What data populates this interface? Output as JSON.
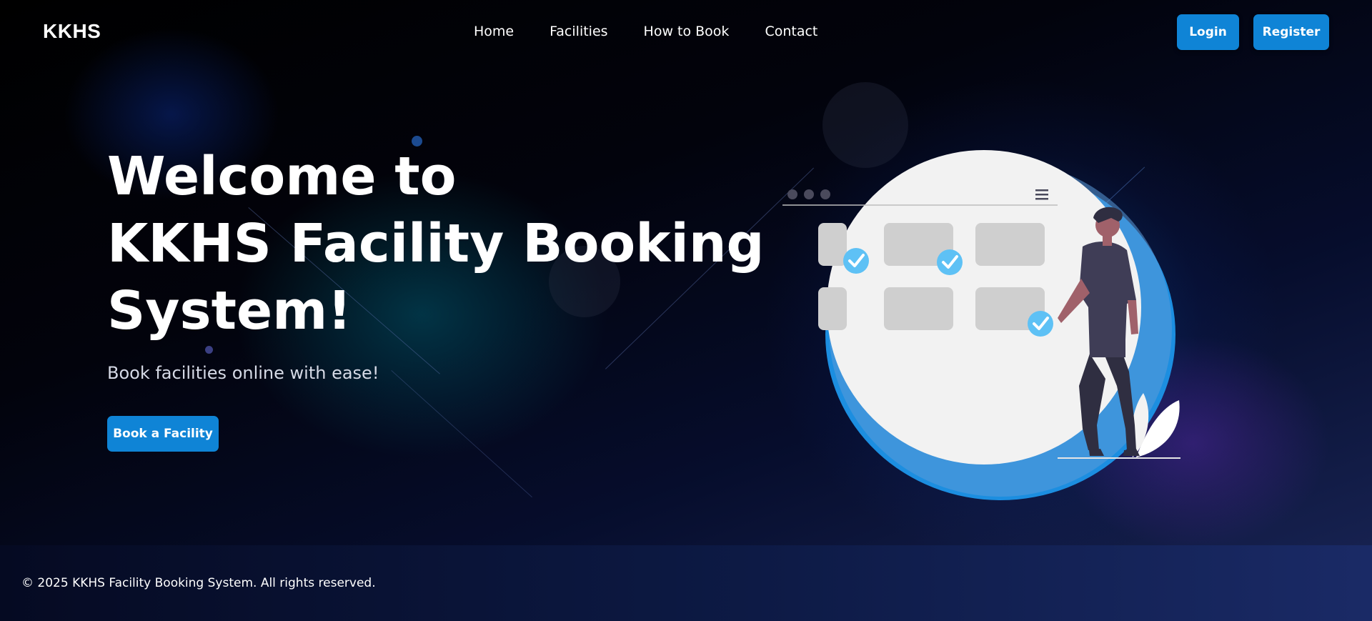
{
  "app": {
    "logo": "KKHS"
  },
  "nav": {
    "items": [
      {
        "label": "Home"
      },
      {
        "label": "Facilities"
      },
      {
        "label": "How to Book"
      },
      {
        "label": "Contact"
      }
    ]
  },
  "auth": {
    "login_label": "Login",
    "register_label": "Register"
  },
  "hero": {
    "title_line1": "Welcome to",
    "title_line2": "KKHS Facility Booking",
    "title_line3": "System!",
    "subtitle": "Book facilities online with ease!",
    "cta_label": "Book a Facility"
  },
  "illustration": {
    "icons": [
      "calendar-grid-icon",
      "check-circle-icon",
      "menu-icon",
      "person-figure"
    ]
  },
  "footer": {
    "copyright": "© 2025 KKHS Facility Booking System. All rights reserved."
  },
  "colors": {
    "accent": "#0f84d6",
    "check": "#5ec1f5",
    "background": "#02030c",
    "card": "#f2f2f2",
    "slot": "#cfcfcf"
  }
}
